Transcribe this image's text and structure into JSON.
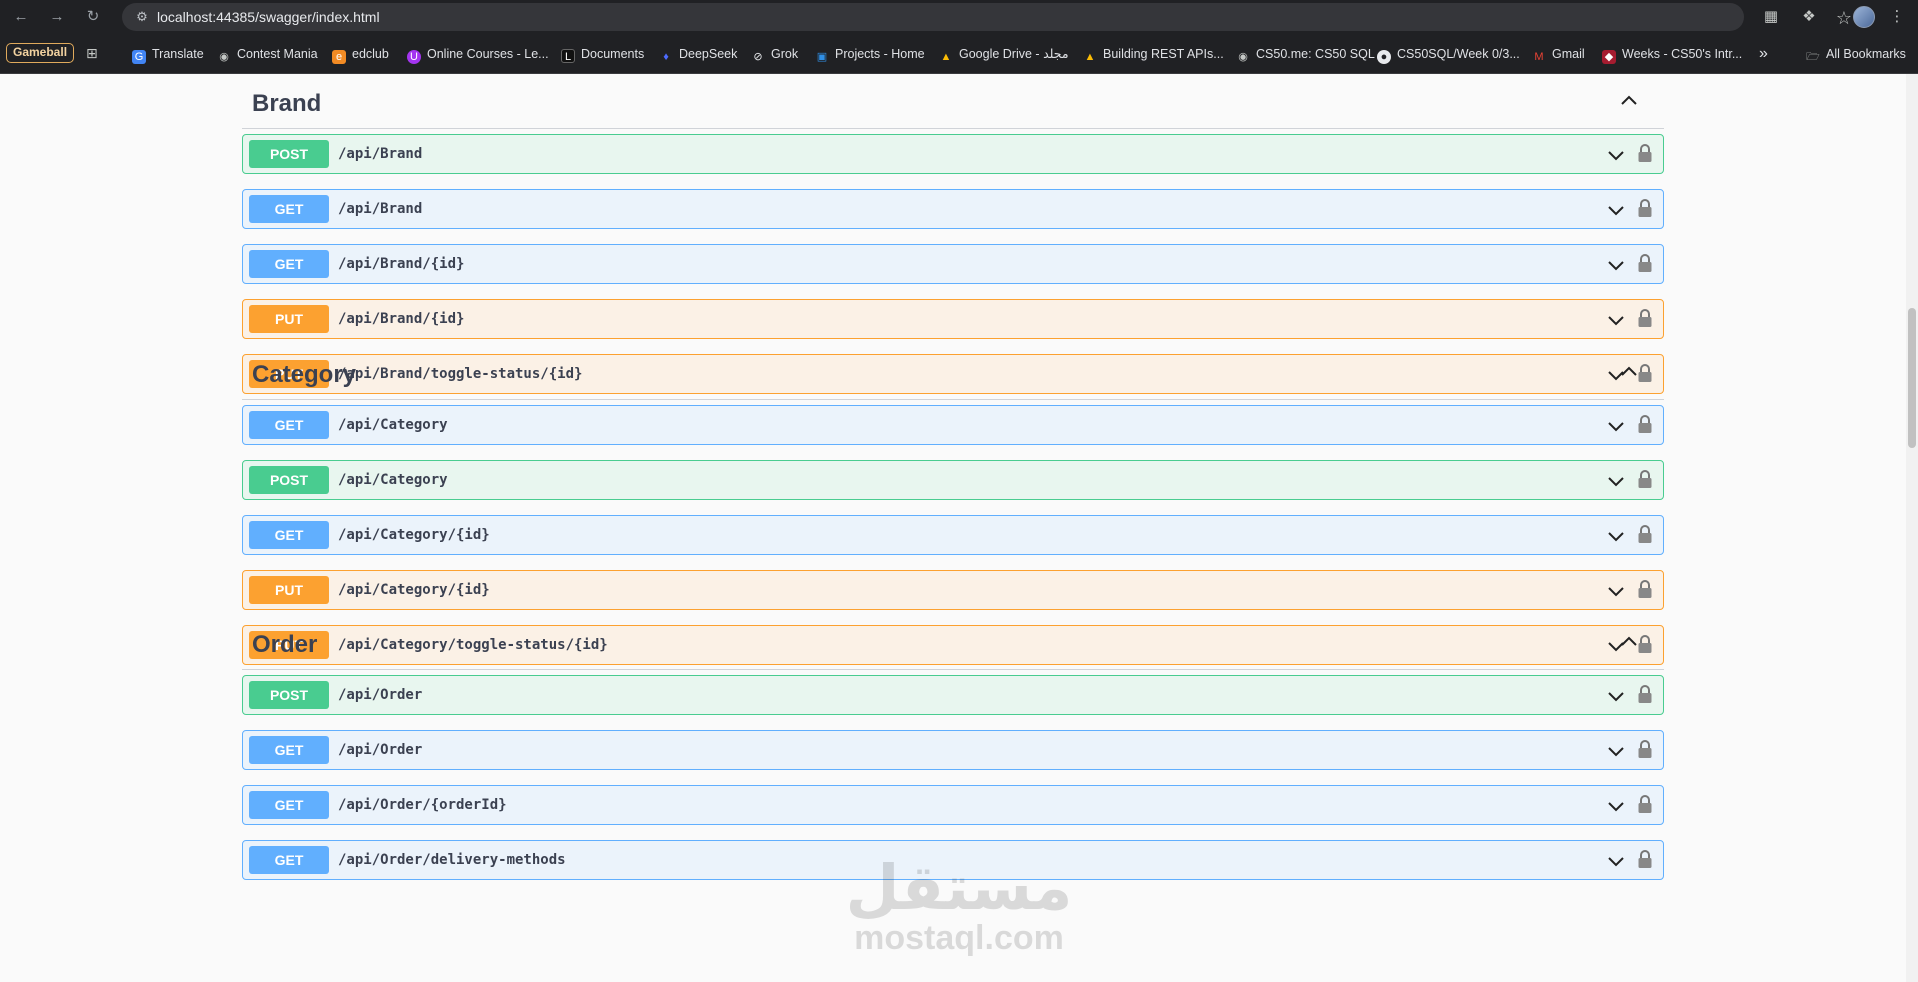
{
  "browser": {
    "url": "localhost:44385/swagger/index.html",
    "bookmarks": [
      {
        "label": "Gameball",
        "icon": "gameball-badge"
      },
      {
        "label": "Translate",
        "icon": "translate-icon"
      },
      {
        "label": "Contest Mania",
        "icon": "globe-icon"
      },
      {
        "label": "edclub",
        "icon": "edclub-icon"
      },
      {
        "label": "Online Courses - Le...",
        "icon": "udemy-icon"
      },
      {
        "label": "Documents",
        "icon": "document-icon"
      },
      {
        "label": "DeepSeek",
        "icon": "deepseek-icon"
      },
      {
        "label": "Grok",
        "icon": "grok-icon"
      },
      {
        "label": "Projects - Home",
        "icon": "azure-devops-icon"
      },
      {
        "label": "Google Drive - مجلد",
        "icon": "google-drive-icon"
      },
      {
        "label": "Building REST APIs...",
        "icon": "google-drive-icon"
      },
      {
        "label": "CS50.me: CS50 SQL",
        "icon": "globe-icon"
      },
      {
        "label": "CS50SQL/Week 0/3...",
        "icon": "github-icon"
      },
      {
        "label": "Gmail",
        "icon": "gmail-icon"
      },
      {
        "label": "Weeks - CS50's Intr...",
        "icon": "harvard-icon"
      }
    ],
    "overflow_label": "»",
    "all_bookmarks_label": "All Bookmarks"
  },
  "sections": [
    {
      "title": "Brand",
      "operations": [
        {
          "method": "POST",
          "path": "/api/Brand"
        },
        {
          "method": "GET",
          "path": "/api/Brand"
        },
        {
          "method": "GET",
          "path": "/api/Brand/{id}"
        },
        {
          "method": "PUT",
          "path": "/api/Brand/{id}"
        },
        {
          "method": "PUT",
          "path": "/api/Brand/toggle-status/{id}"
        }
      ]
    },
    {
      "title": "Category",
      "operations": [
        {
          "method": "GET",
          "path": "/api/Category"
        },
        {
          "method": "POST",
          "path": "/api/Category"
        },
        {
          "method": "GET",
          "path": "/api/Category/{id}"
        },
        {
          "method": "PUT",
          "path": "/api/Category/{id}"
        },
        {
          "method": "PUT",
          "path": "/api/Category/toggle-status/{id}"
        }
      ]
    },
    {
      "title": "Order",
      "operations": [
        {
          "method": "POST",
          "path": "/api/Order"
        },
        {
          "method": "GET",
          "path": "/api/Order"
        },
        {
          "method": "GET",
          "path": "/api/Order/{orderId}"
        },
        {
          "method": "GET",
          "path": "/api/Order/delivery-methods"
        }
      ]
    }
  ],
  "watermark": {
    "arabic": "مستقل",
    "latin": "mostaql.com"
  },
  "colors": {
    "post": "#49cc90",
    "get": "#61affe",
    "put": "#fca130",
    "text": "#3b4151"
  }
}
